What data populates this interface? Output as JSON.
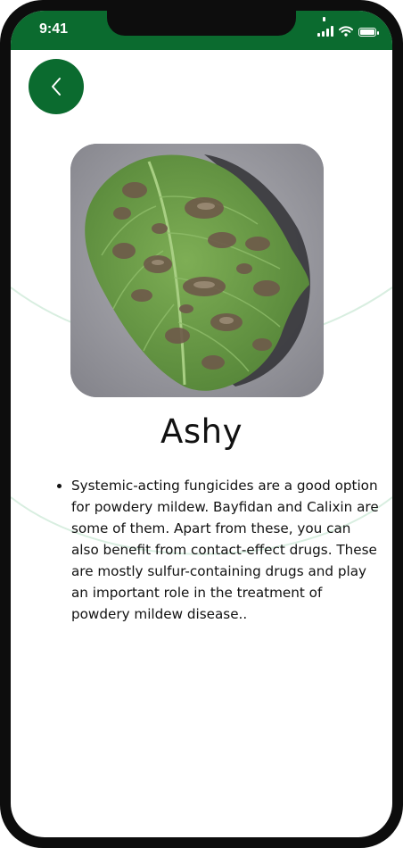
{
  "status_bar": {
    "time": "9:41",
    "icons": [
      "cellular-signal-icon",
      "wifi-icon",
      "battery-icon"
    ],
    "background_color": "#0b6b2f",
    "privacy_indicator_color": "#ff9500"
  },
  "navigation": {
    "back_icon": "chevron-left-icon",
    "button_color": "#0b6b2f"
  },
  "disease": {
    "image_subject": "leaf-with-powdery-mildew",
    "name": "Ashy",
    "treatment_points": [
      "Systemic-acting fungicides are a good option for powdery mildew. Bayfidan and Calixin are some of them. Apart from these, you can also benefit from contact-effect drugs. These are mostly sulfur-containing drugs and play an important role in the treatment of powdery mildew disease.."
    ]
  }
}
